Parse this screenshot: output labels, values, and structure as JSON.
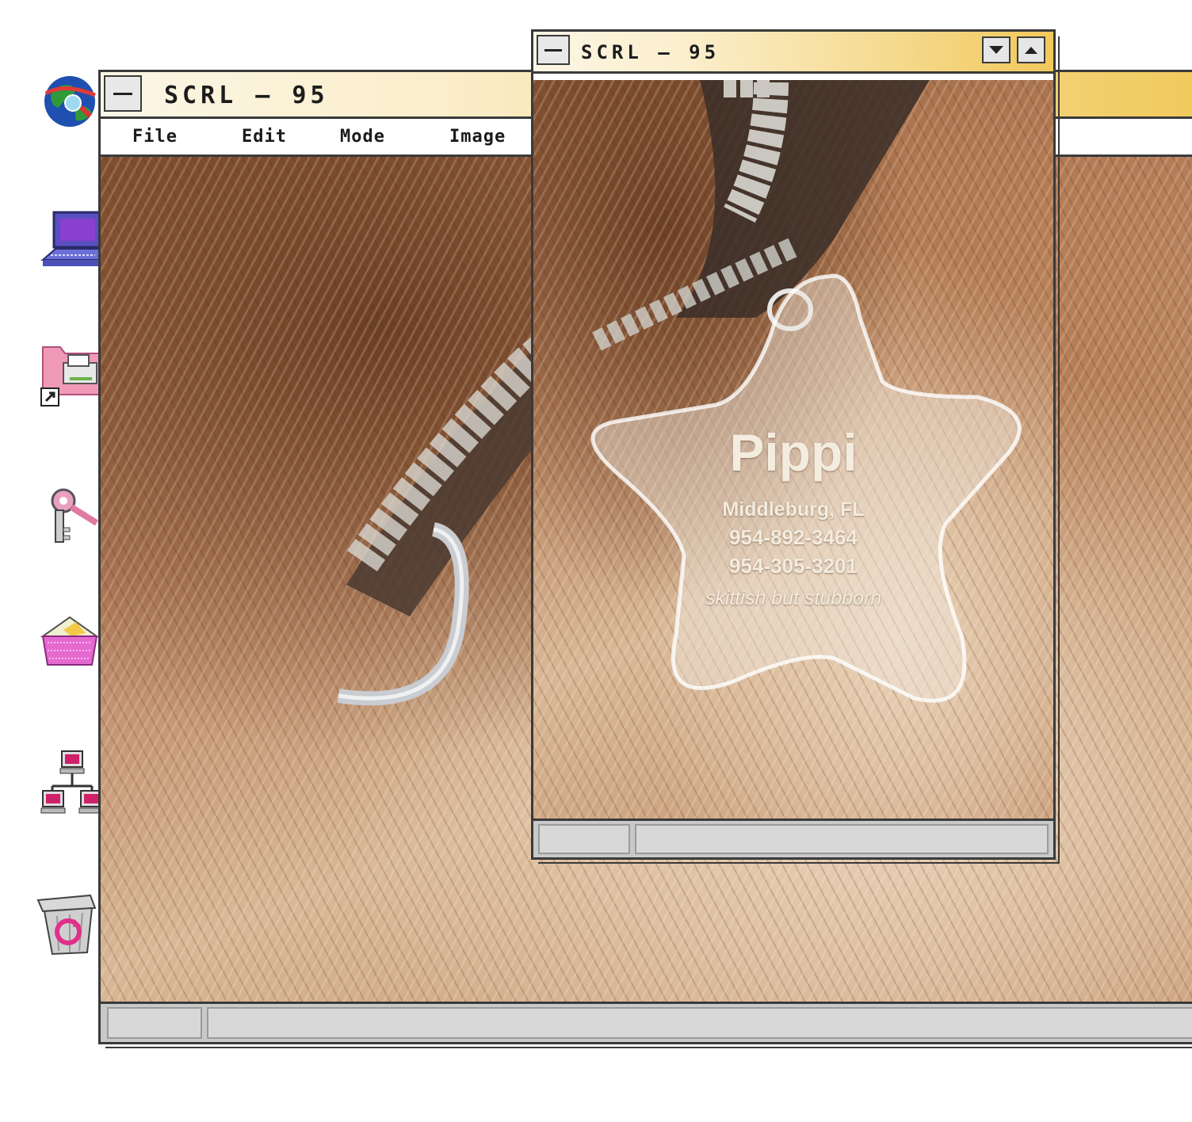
{
  "desktop": {
    "icons": [
      {
        "name": "internet-explorer-icon"
      },
      {
        "name": "my-computer-icon"
      },
      {
        "name": "printers-folder-shortcut-icon"
      },
      {
        "name": "passwords-keys-icon"
      },
      {
        "name": "inbox-icon"
      },
      {
        "name": "network-neighborhood-icon"
      },
      {
        "name": "recycle-bin-icon"
      }
    ]
  },
  "main_window": {
    "title": "SCRL — 95",
    "menu": [
      "File",
      "Edit",
      "Mode",
      "Image"
    ]
  },
  "front_window": {
    "title": "SCRL — 95"
  },
  "pet_tag": {
    "name": "Pippi",
    "city": "Middleburg, FL",
    "phone_1": "954-892-3464",
    "phone_2": "954-305-3201",
    "note": "skittish but stubborn"
  },
  "colors": {
    "titlebar_start": "#fbf6e6",
    "titlebar_end": "#f1c95a",
    "frame": "#3a3a3a",
    "statusbar": "#c9c9c9"
  }
}
